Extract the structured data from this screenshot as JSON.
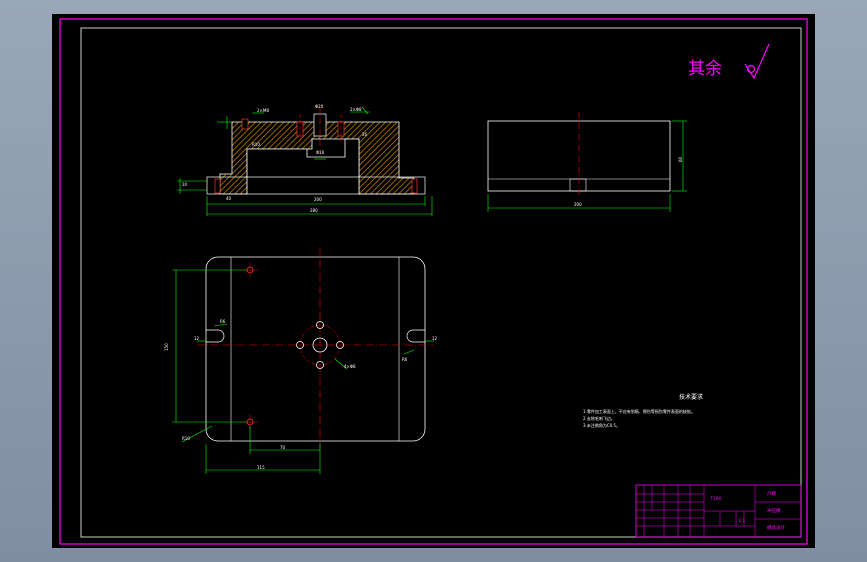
{
  "colors": {
    "background": "#000000",
    "frame": "#ff00ff",
    "geometry": "#ffffff",
    "dimension": "#00ff00",
    "centerline": "#ff0000",
    "title_block": "#ff00ff",
    "app_bg": "#8a99ad"
  },
  "roughness": {
    "text": "其余"
  },
  "tech_requirements": {
    "title": "技术要求",
    "lines": [
      "1.零件加工表面上，不应有划痕、擦伤等损伤零件表面的缺陷。",
      "2.去除毛刺飞边。",
      "3.未注倒角为C0.5。"
    ]
  },
  "title_block": {
    "part_name": "凸模",
    "material": "T10A",
    "drawing_name": "冲压模",
    "school": "模具设计",
    "scale": "1:1"
  },
  "icons": [
    "roughness-symbol-icon"
  ]
}
